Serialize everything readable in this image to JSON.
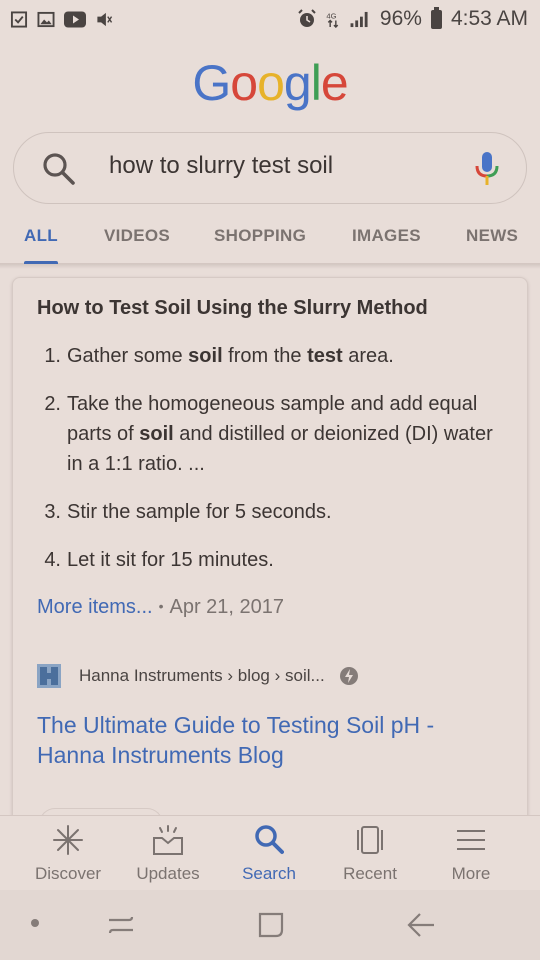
{
  "status_bar": {
    "battery_percent": "96%",
    "time": "4:53 AM",
    "left_icons": [
      "checkbox-icon",
      "image-icon",
      "youtube-icon",
      "mute-icon"
    ],
    "right_icons": [
      "alarm-icon",
      "data-icon",
      "signal-icon",
      "battery-icon"
    ]
  },
  "logo": {
    "letters": [
      "G",
      "o",
      "o",
      "g",
      "l",
      "e"
    ],
    "colors": [
      "#4a74c7",
      "#d6473a",
      "#e7b22a",
      "#4a74c7",
      "#3f9e55",
      "#d6473a"
    ]
  },
  "search": {
    "query": "how to slurry test soil",
    "icon": "search-icon",
    "mic_icon": "mic-icon"
  },
  "tabs": [
    {
      "label": "ALL",
      "active": true
    },
    {
      "label": "VIDEOS",
      "active": false
    },
    {
      "label": "SHOPPING",
      "active": false
    },
    {
      "label": "IMAGES",
      "active": false
    },
    {
      "label": "NEWS",
      "active": false
    }
  ],
  "snippet": {
    "title": "How to Test Soil Using the Slurry Method",
    "steps": [
      {
        "num": "1.",
        "parts": [
          {
            "t": "Gather some "
          },
          {
            "t": "soil",
            "b": true
          },
          {
            "t": " from the "
          },
          {
            "t": "test",
            "b": true
          },
          {
            "t": " area."
          }
        ]
      },
      {
        "num": "2.",
        "parts": [
          {
            "t": "Take the homogeneous sample and add equal parts of "
          },
          {
            "t": "soil",
            "b": true
          },
          {
            "t": " and distilled or deionized (DI) water in a 1:1 ratio. ..."
          }
        ]
      },
      {
        "num": "3.",
        "parts": [
          {
            "t": "Stir the sample for 5 seconds."
          }
        ]
      },
      {
        "num": "4.",
        "parts": [
          {
            "t": "Let it sit for 15 minutes."
          }
        ]
      }
    ],
    "more_items": "More items...",
    "separator": "•",
    "date": "Apr 21, 2017",
    "source": "Hanna Instruments › blog › soil...",
    "result_title": "The Ultimate Guide to Testing Soil pH - Hanna Instruments Blog"
  },
  "app_nav": [
    {
      "label": "Discover",
      "icon": "discover-icon",
      "active": false
    },
    {
      "label": "Updates",
      "icon": "updates-icon",
      "active": false
    },
    {
      "label": "Search",
      "icon": "search-icon",
      "active": true
    },
    {
      "label": "Recent",
      "icon": "recent-icon",
      "active": false
    },
    {
      "label": "More",
      "icon": "menu-icon",
      "active": false
    }
  ],
  "system_nav": [
    "dot-icon",
    "recents-icon",
    "home-icon",
    "back-icon"
  ],
  "colors": {
    "accent": "#4169b4",
    "background": "#e8ddd8",
    "text": "#3c3533",
    "muted": "#7b7370"
  }
}
